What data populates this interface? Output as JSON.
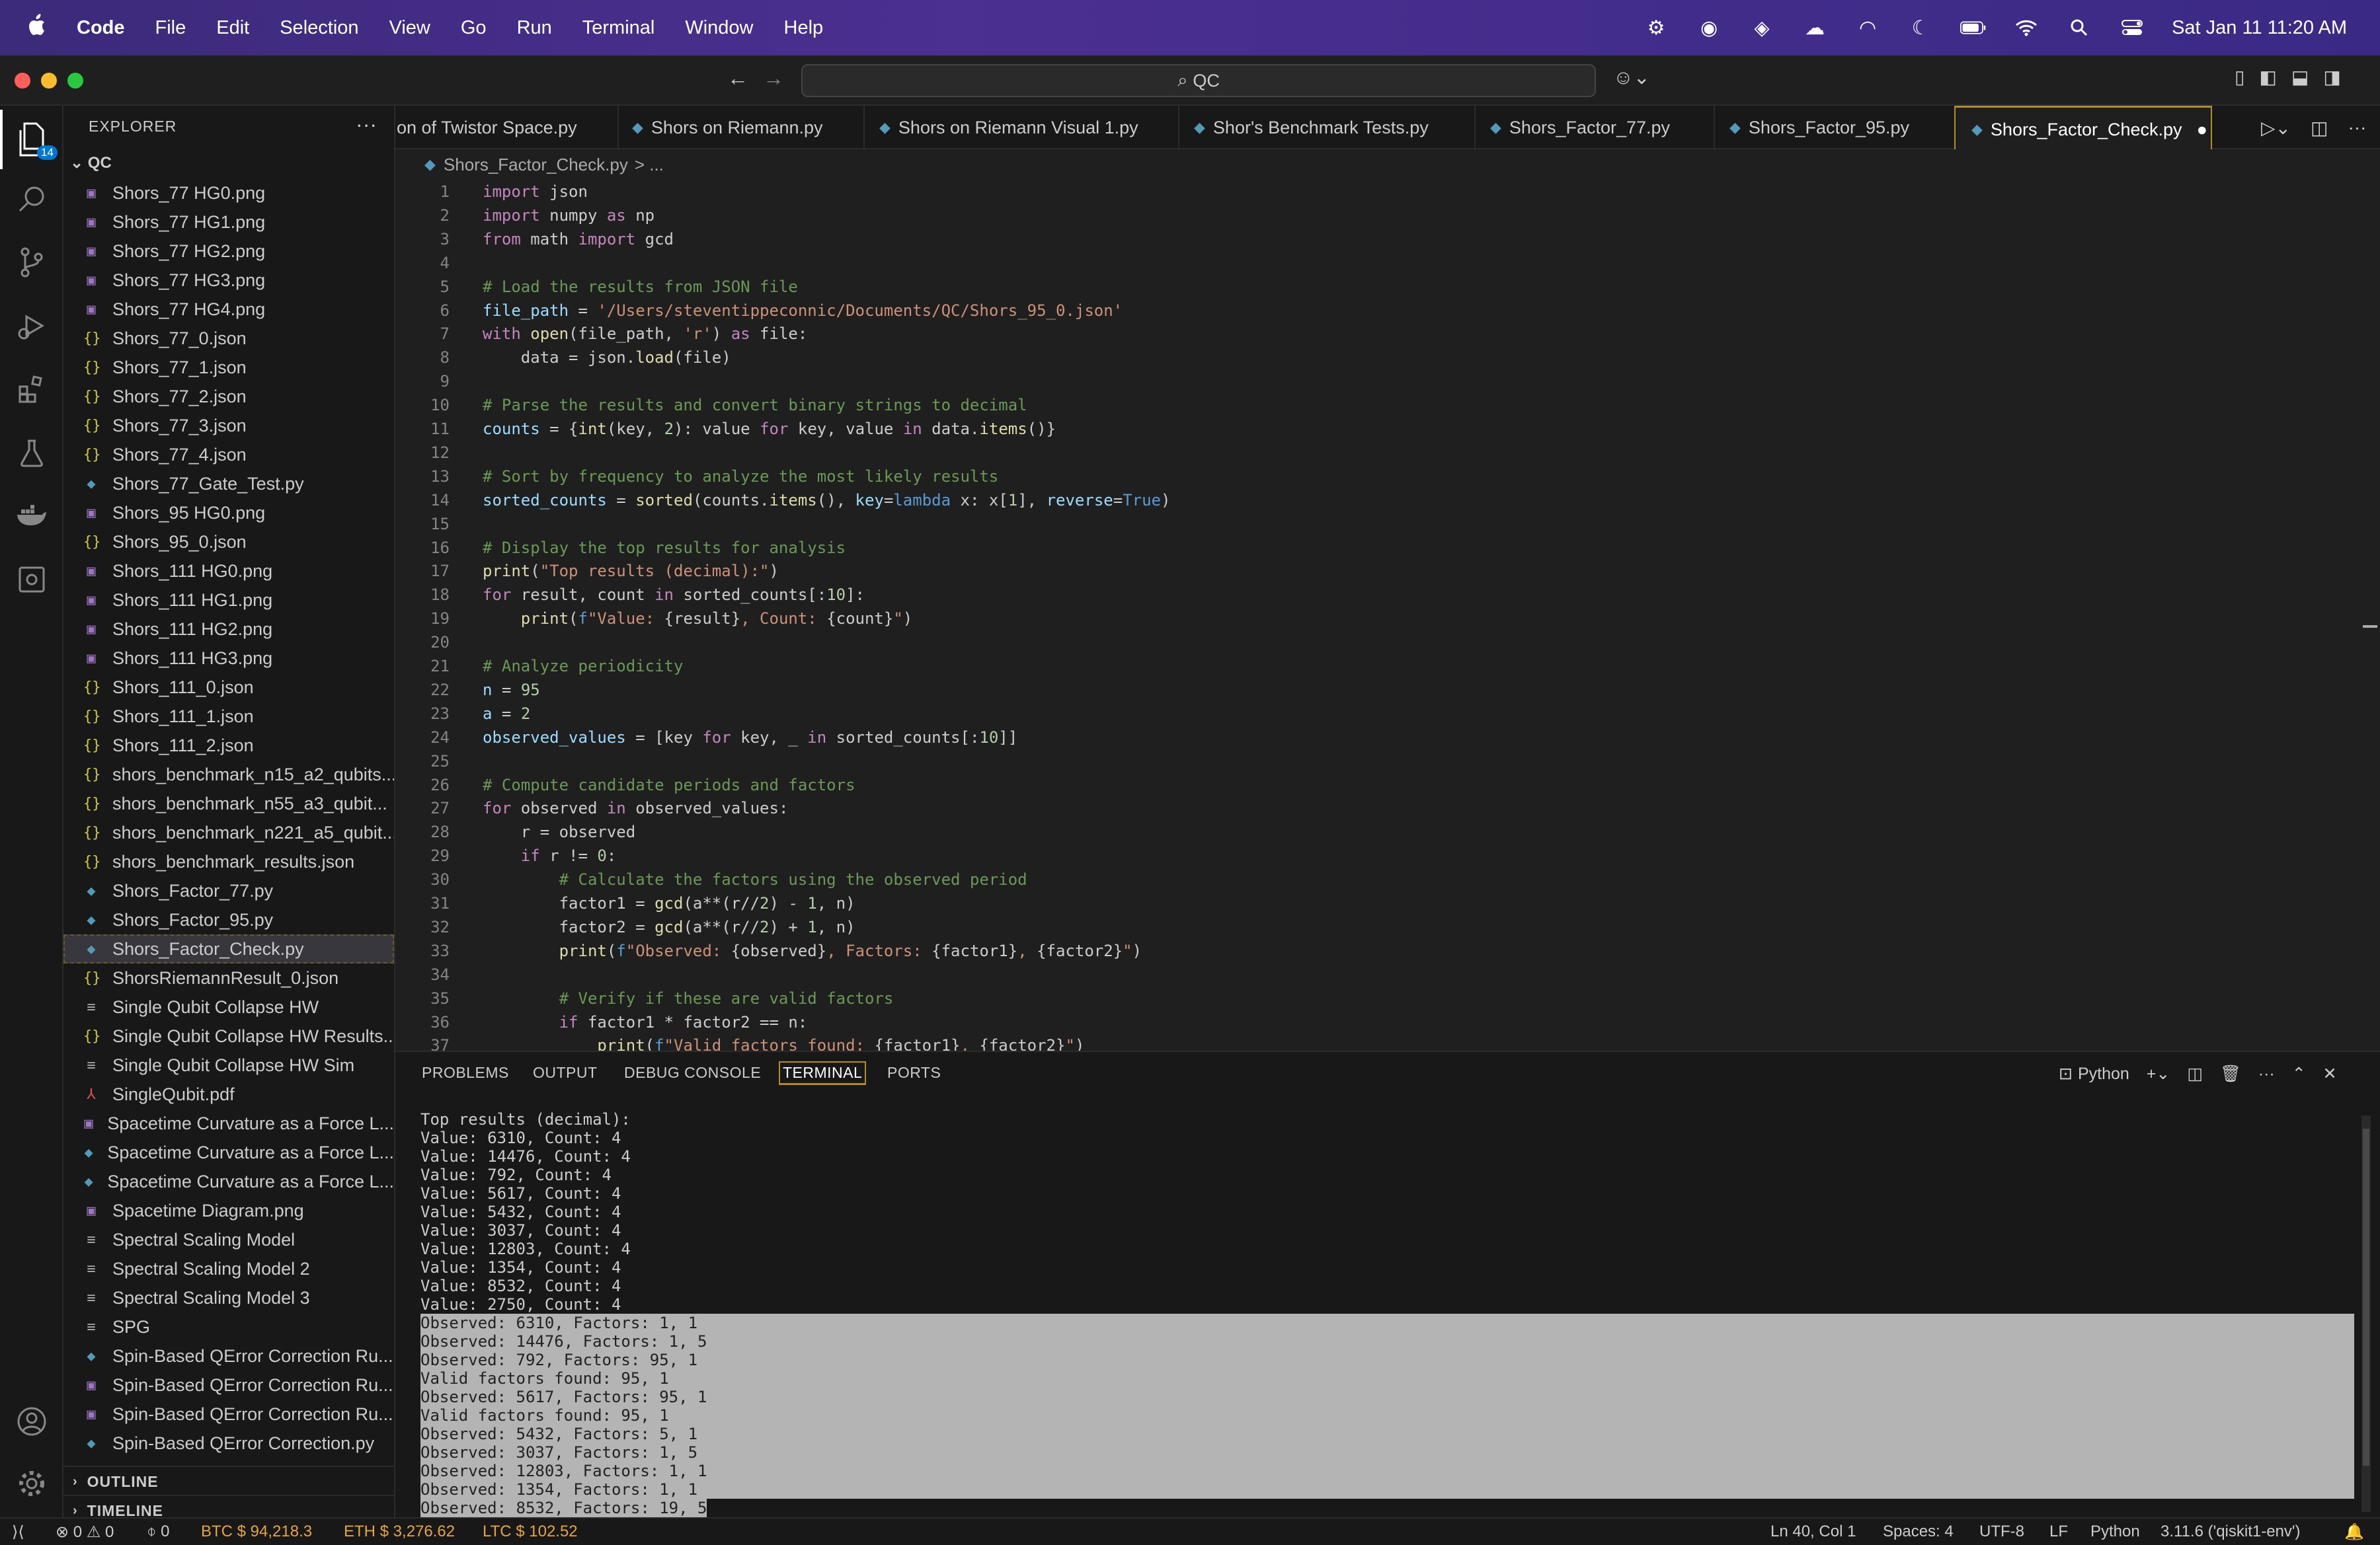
{
  "menubar": {
    "app": "Code",
    "items": [
      "File",
      "Edit",
      "Selection",
      "View",
      "Go",
      "Run",
      "Terminal",
      "Window",
      "Help"
    ],
    "clock": "Sat Jan 11  11:20 AM"
  },
  "titlebar": {
    "search": "QC"
  },
  "activity": {
    "explorer_badge": "14"
  },
  "sidebar": {
    "header": "EXPLORER",
    "root": "QC",
    "files": [
      {
        "name": "Shors_77 HG0.png",
        "type": "img"
      },
      {
        "name": "Shors_77 HG1.png",
        "type": "img"
      },
      {
        "name": "Shors_77 HG2.png",
        "type": "img"
      },
      {
        "name": "Shors_77 HG3.png",
        "type": "img"
      },
      {
        "name": "Shors_77 HG4.png",
        "type": "img"
      },
      {
        "name": "Shors_77_0.json",
        "type": "json"
      },
      {
        "name": "Shors_77_1.json",
        "type": "json"
      },
      {
        "name": "Shors_77_2.json",
        "type": "json"
      },
      {
        "name": "Shors_77_3.json",
        "type": "json"
      },
      {
        "name": "Shors_77_4.json",
        "type": "json"
      },
      {
        "name": "Shors_77_Gate_Test.py",
        "type": "py"
      },
      {
        "name": "Shors_95 HG0.png",
        "type": "img"
      },
      {
        "name": "Shors_95_0.json",
        "type": "json"
      },
      {
        "name": "Shors_111 HG0.png",
        "type": "img"
      },
      {
        "name": "Shors_111 HG1.png",
        "type": "img"
      },
      {
        "name": "Shors_111 HG2.png",
        "type": "img"
      },
      {
        "name": "Shors_111 HG3.png",
        "type": "img"
      },
      {
        "name": "Shors_111_0.json",
        "type": "json"
      },
      {
        "name": "Shors_111_1.json",
        "type": "json"
      },
      {
        "name": "Shors_111_2.json",
        "type": "json"
      },
      {
        "name": "shors_benchmark_n15_a2_qubits...",
        "type": "json"
      },
      {
        "name": "shors_benchmark_n55_a3_qubit...",
        "type": "json"
      },
      {
        "name": "shors_benchmark_n221_a5_qubit...",
        "type": "json"
      },
      {
        "name": "shors_benchmark_results.json",
        "type": "json"
      },
      {
        "name": "Shors_Factor_77.py",
        "type": "py"
      },
      {
        "name": "Shors_Factor_95.py",
        "type": "py"
      },
      {
        "name": "Shors_Factor_Check.py",
        "type": "py",
        "selected": true
      },
      {
        "name": "ShorsRiemannResult_0.json",
        "type": "json"
      },
      {
        "name": "Single Qubit Collapse HW",
        "type": "txt"
      },
      {
        "name": "Single Qubit Collapse HW Results...",
        "type": "json"
      },
      {
        "name": "Single Qubit Collapse HW Sim",
        "type": "txt"
      },
      {
        "name": "SingleQubit.pdf",
        "type": "pdf"
      },
      {
        "name": "Spacetime Curvature as a Force L...",
        "type": "img"
      },
      {
        "name": "Spacetime Curvature as a Force L...",
        "type": "py"
      },
      {
        "name": "Spacetime Curvature as a Force L...",
        "type": "py"
      },
      {
        "name": "Spacetime Diagram.png",
        "type": "img"
      },
      {
        "name": "Spectral Scaling Model",
        "type": "txt"
      },
      {
        "name": "Spectral Scaling Model 2",
        "type": "txt"
      },
      {
        "name": "Spectral Scaling Model 3",
        "type": "txt"
      },
      {
        "name": "SPG",
        "type": "txt"
      },
      {
        "name": "Spin-Based QError Correction Ru...",
        "type": "py"
      },
      {
        "name": "Spin-Based QError Correction Ru...",
        "type": "img"
      },
      {
        "name": "Spin-Based QError Correction Ru...",
        "type": "img"
      },
      {
        "name": "Spin-Based QError Correction.py",
        "type": "py"
      }
    ],
    "outline": "OUTLINE",
    "timeline": "TIMELINE"
  },
  "tabs": [
    {
      "label": "on of Twistor Space.py",
      "icon": false
    },
    {
      "label": "Shors on Riemann.py",
      "icon": true
    },
    {
      "label": "Shors on Riemann Visual 1.py",
      "icon": true
    },
    {
      "label": "Shor's Benchmark Tests.py",
      "icon": true
    },
    {
      "label": "Shors_Factor_77.py",
      "icon": true
    },
    {
      "label": "Shors_Factor_95.py",
      "icon": true
    },
    {
      "label": "Shors_Factor_Check.py",
      "icon": true,
      "active": true,
      "dirty": "●"
    }
  ],
  "breadcrumb": {
    "file": "Shors_Factor_Check.py",
    "rest": "> ..."
  },
  "editor": {
    "lines": [
      "<span class=\"kw\">import</span> json",
      "<span class=\"kw\">import</span> numpy <span class=\"kw\">as</span> np",
      "<span class=\"kw\">from</span> math <span class=\"kw\">import</span> gcd",
      "",
      "<span class=\"cm\"># Load the results from JSON file</span>",
      "<span class=\"var\">file_path</span> = <span class=\"str\">'/Users/steventippeconnic/Documents/QC/Shors_95_0.json'</span>",
      "<span class=\"kw\">with</span> <span class=\"fn\">open</span>(file_path, <span class=\"str\">'r'</span>) <span class=\"kw\">as</span> file:",
      "    data = json.<span class=\"fn\">load</span>(file)",
      "",
      "<span class=\"cm\"># Parse the results and convert binary strings to decimal</span>",
      "<span class=\"var\">counts</span> = {<span class=\"fn\">int</span>(key, <span class=\"num\">2</span>): value <span class=\"kw\">for</span> key, value <span class=\"kw\">in</span> data.<span class=\"fn\">items</span>()}",
      "",
      "<span class=\"cm\"># Sort by frequency to analyze the most likely results</span>",
      "<span class=\"var\">sorted_counts</span> = <span class=\"fn\">sorted</span>(counts.<span class=\"fn\">items</span>(), <span class=\"var\">key</span>=<span class=\"kw2\">lambda</span> x: x[<span class=\"num\">1</span>], <span class=\"var\">reverse</span>=<span class=\"kw2\">True</span>)",
      "",
      "<span class=\"cm\"># Display the top results for analysis</span>",
      "<span class=\"fn\">print</span>(<span class=\"str\">\"Top results (decimal):\"</span>)",
      "<span class=\"kw\">for</span> result, count <span class=\"kw\">in</span> sorted_counts[:<span class=\"num\">10</span>]:",
      "    <span class=\"fn\">print</span>(<span class=\"kw2\">f</span><span class=\"str\">\"Value: </span>{result}<span class=\"str\">, Count: </span>{count}<span class=\"str\">\"</span>)",
      "",
      "<span class=\"cm\"># Analyze periodicity</span>",
      "<span class=\"var\">n</span> = <span class=\"num\">95</span>",
      "<span class=\"var\">a</span> = <span class=\"num\">2</span>",
      "<span class=\"var\">observed_values</span> = [key <span class=\"kw\">for</span> key, _ <span class=\"kw\">in</span> sorted_counts[:<span class=\"num\">10</span>]]",
      "",
      "<span class=\"cm\"># Compute candidate periods and factors</span>",
      "<span class=\"kw\">for</span> observed <span class=\"kw\">in</span> observed_values:",
      "    r = observed",
      "    <span class=\"kw\">if</span> r != <span class=\"num\">0</span>:",
      "        <span class=\"cm\"># Calculate the factors using the observed period</span>",
      "        factor1 = <span class=\"fn\">gcd</span>(a**(r//<span class=\"num\">2</span>) - <span class=\"num\">1</span>, n)",
      "        factor2 = <span class=\"fn\">gcd</span>(a**(r//<span class=\"num\">2</span>) + <span class=\"num\">1</span>, n)",
      "        <span class=\"fn\">print</span>(<span class=\"kw2\">f</span><span class=\"str\">\"Observed: </span>{observed}<span class=\"str\">, Factors: </span>{factor1}<span class=\"str\">, </span>{factor2}<span class=\"str\">\"</span>)",
      "",
      "        <span class=\"cm\"># Verify if these are valid factors</span>",
      "        <span class=\"kw\">if</span> factor1 * factor2 == n:",
      "            <span class=\"fn\">print</span>(<span class=\"kw2\">f</span><span class=\"str\">\"Valid factors found: </span>{factor1}<span class=\"str\">, </span>{factor2}<span class=\"str\">\"</span>)"
    ]
  },
  "panel": {
    "tabs": [
      "PROBLEMS",
      "OUTPUT",
      "DEBUG CONSOLE",
      "TERMINAL",
      "PORTS"
    ],
    "active_tab": "TERMINAL",
    "shell": "Python",
    "terminal_lines": [
      "Top results (decimal):",
      "Value: 6310, Count: 4",
      "Value: 14476, Count: 4",
      "Value: 792, Count: 4",
      "Value: 5617, Count: 4",
      "Value: 5432, Count: 4",
      "Value: 3037, Count: 4",
      "Value: 12803, Count: 4",
      "Value: 1354, Count: 4",
      "Value: 8532, Count: 4",
      "Value: 2750, Count: 4",
      "Observed: 6310, Factors: 1, 1",
      "Observed: 14476, Factors: 1, 5",
      "Observed: 792, Factors: 95, 1",
      "Valid factors found: 95, 1",
      "Observed: 5617, Factors: 95, 1",
      "Valid factors found: 95, 1",
      "Observed: 5432, Factors: 5, 1",
      "Observed: 3037, Factors: 1, 5",
      "Observed: 12803, Factors: 1, 1",
      "Observed: 1354, Factors: 1, 1",
      "Observed: 8532, Factors: 19, 5"
    ],
    "highlight_from": 11
  },
  "statusbar": {
    "errors": "0",
    "warnings": "0",
    "ports": "0",
    "btc": "BTC $ 94,218.3",
    "eth": "ETH $ 3,276.62",
    "ltc": "LTC $ 102.52",
    "position": "Ln 40, Col 1",
    "spaces": "Spaces: 4",
    "encoding": "UTF-8",
    "eol": "LF",
    "language": "Python",
    "interpreter": "3.11.6 ('qiskit1-env')"
  }
}
